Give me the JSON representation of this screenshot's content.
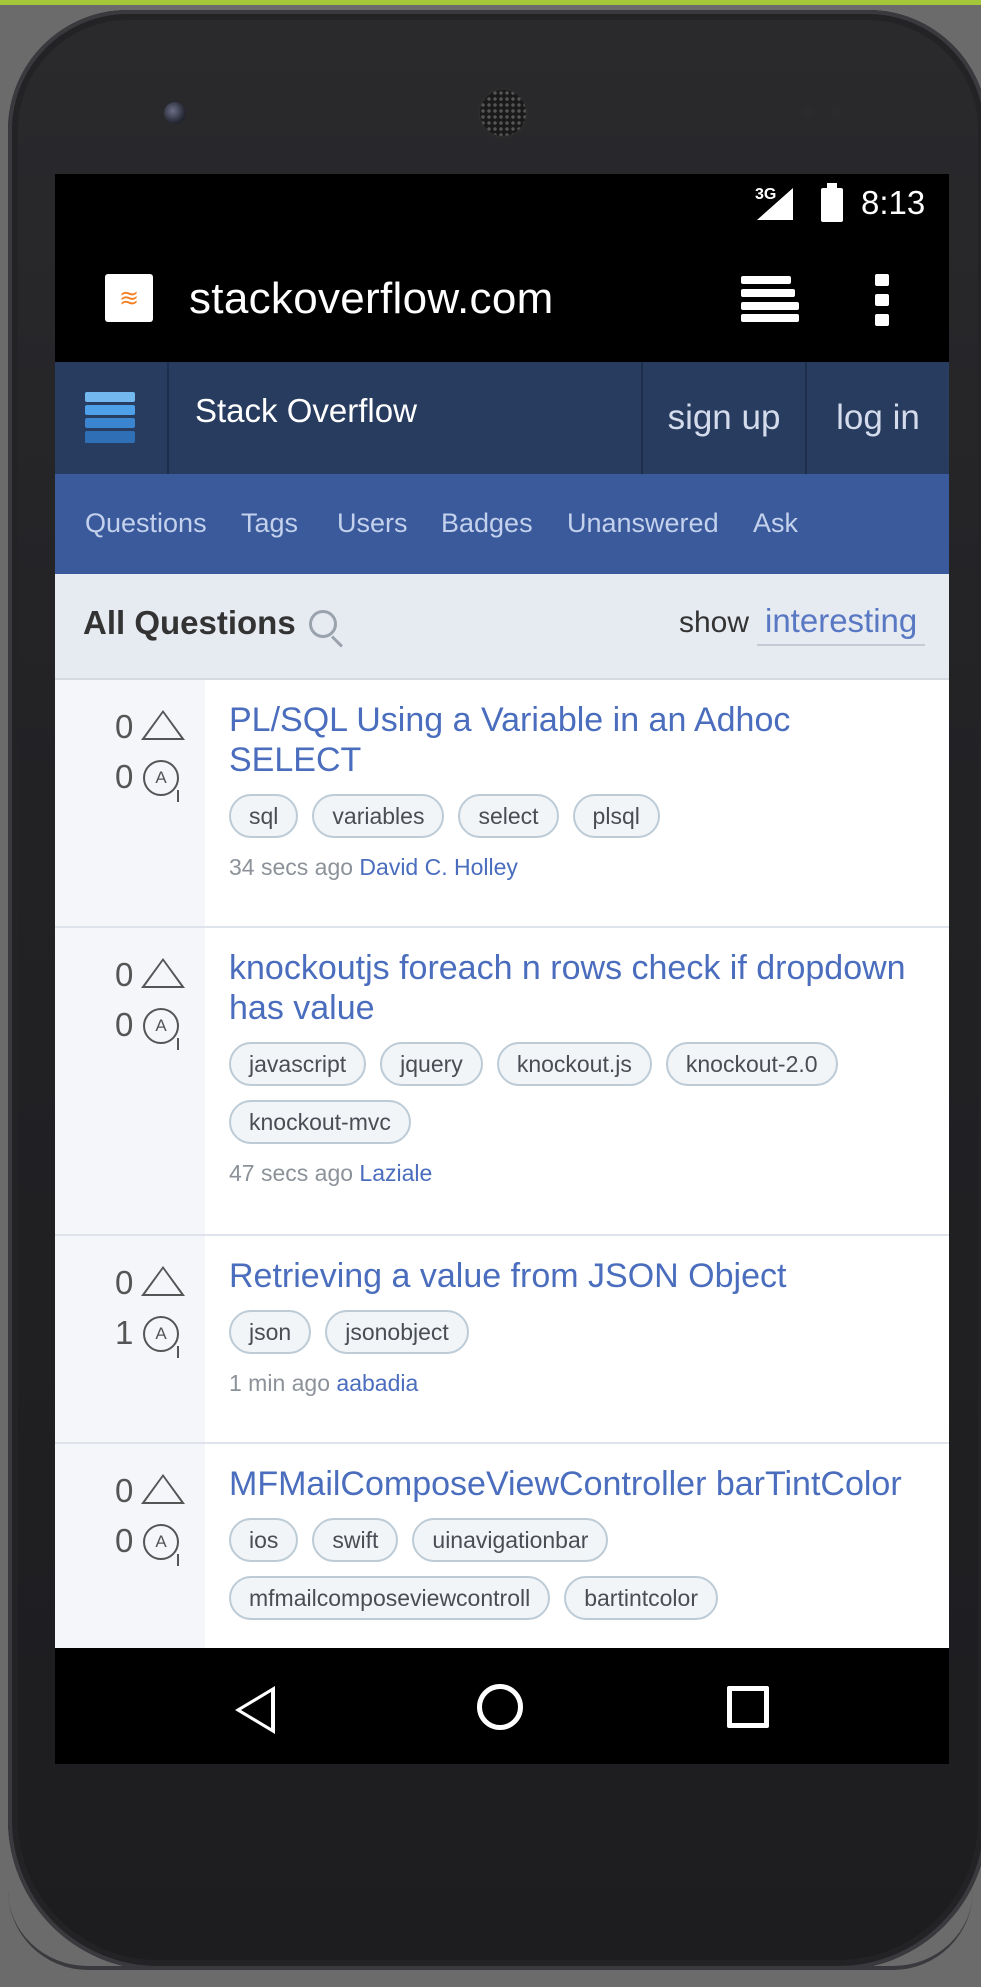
{
  "status_bar": {
    "network": "3G",
    "time": "8:13"
  },
  "browser": {
    "url": "stackoverflow.com"
  },
  "site_header": {
    "title": "Stack Overflow",
    "signup": "sign up",
    "login": "log in"
  },
  "subnav": [
    "Questions",
    "Tags",
    "Users",
    "Badges",
    "Unanswered",
    "Ask"
  ],
  "list_header": {
    "title": "All Questions",
    "show_label": "show",
    "filter": "interesting"
  },
  "questions": [
    {
      "votes": "0",
      "answers": "0",
      "answer_icon": "A",
      "title": "PL/SQL Using a Variable in an Adhoc SELECT",
      "tags": [
        "sql",
        "variables",
        "select",
        "plsql"
      ],
      "time": "34 secs ago",
      "user": "David C. Holley"
    },
    {
      "votes": "0",
      "answers": "0",
      "answer_icon": "A",
      "title": "knockoutjs foreach n rows check if dropdown has value",
      "tags": [
        "javascript",
        "jquery",
        "knockout.js",
        "knockout-2.0",
        "knockout-mvc"
      ],
      "time": "47 secs ago",
      "user": "Laziale"
    },
    {
      "votes": "0",
      "answers": "1",
      "answer_icon": "A",
      "title": "Retrieving a value from JSON Object",
      "tags": [
        "json",
        "jsonobject"
      ],
      "time": "1 min ago",
      "user": "aabadia"
    },
    {
      "votes": "0",
      "answers": "0",
      "answer_icon": "A",
      "title": "MFMailComposeViewController barTintColor",
      "tags": [
        "ios",
        "swift",
        "uinavigationbar",
        "mfmailcomposeviewcontroll",
        "bartintcolor"
      ],
      "time": "",
      "user": ""
    }
  ],
  "colors": {
    "header_bg": "#283c60",
    "subnav_bg": "#3a5a9c",
    "link": "#4a6dbd",
    "so_orange": "#f48024"
  },
  "icons": [
    "stackoverflow-favicon",
    "tabs-icon",
    "overflow-menu-icon",
    "stackexchange-logo-icon",
    "search-icon",
    "upvote-icon",
    "answer-bubble-icon",
    "back-icon",
    "home-icon",
    "recents-icon"
  ]
}
